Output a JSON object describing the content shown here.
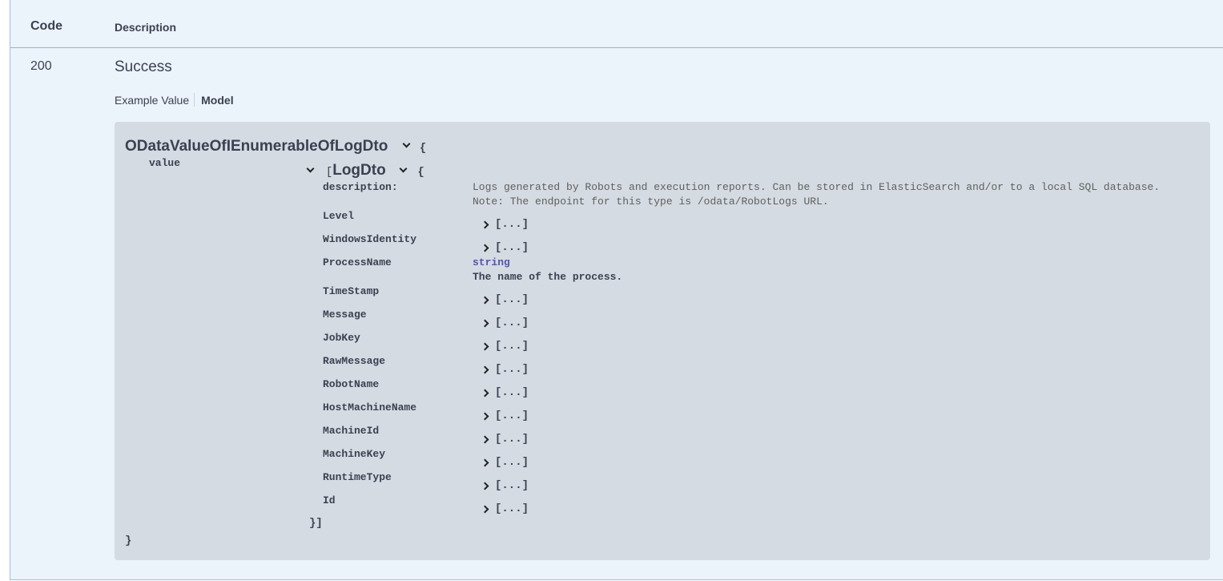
{
  "responses": {
    "header": {
      "code_label": "Code",
      "description_label": "Description"
    },
    "row": {
      "code": "200",
      "description": "Success",
      "tabs": {
        "example_value": "Example Value",
        "model": "Model"
      }
    }
  },
  "model": {
    "name": "ODataValueOfIEnumerableOfLogDto",
    "open_brace": "{",
    "close_brace": "}",
    "property": "value",
    "inner": {
      "open_bracket": "[",
      "name": "LogDto",
      "open_brace": "{",
      "close": "}]",
      "description_label": "description:",
      "description_line1": "Logs generated by Robots and execution reports. Can be stored in ElasticSearch and/or to a local SQL database.",
      "description_line2": "Note: The endpoint for this type is /odata/RobotLogs URL.",
      "collapsed_text": "[...]",
      "process_type": "string",
      "process_description": "The name of the process.",
      "properties": [
        {
          "name": "Level",
          "kind": "collapsed"
        },
        {
          "name": "WindowsIdentity",
          "kind": "collapsed"
        },
        {
          "name": "ProcessName",
          "kind": "string"
        },
        {
          "name": "TimeStamp",
          "kind": "collapsed"
        },
        {
          "name": "Message",
          "kind": "collapsed"
        },
        {
          "name": "JobKey",
          "kind": "collapsed"
        },
        {
          "name": "RawMessage",
          "kind": "collapsed"
        },
        {
          "name": "RobotName",
          "kind": "collapsed"
        },
        {
          "name": "HostMachineName",
          "kind": "collapsed"
        },
        {
          "name": "MachineId",
          "kind": "collapsed"
        },
        {
          "name": "MachineKey",
          "kind": "collapsed"
        },
        {
          "name": "RuntimeType",
          "kind": "collapsed"
        },
        {
          "name": "Id",
          "kind": "collapsed"
        }
      ]
    }
  }
}
